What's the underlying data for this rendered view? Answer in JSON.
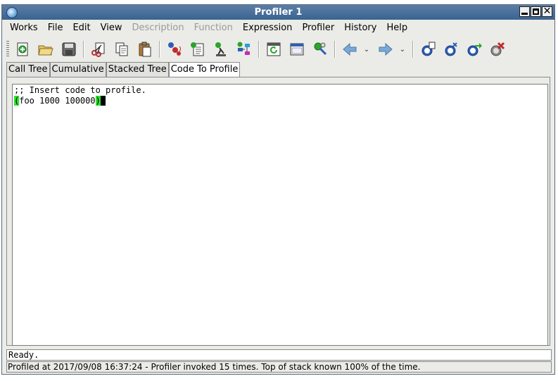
{
  "window": {
    "title": "Profiler 1"
  },
  "menubar": {
    "items": [
      {
        "label": "Works",
        "disabled": false
      },
      {
        "label": "File",
        "disabled": false
      },
      {
        "label": "Edit",
        "disabled": false
      },
      {
        "label": "View",
        "disabled": false
      },
      {
        "label": "Description",
        "disabled": true
      },
      {
        "label": "Function",
        "disabled": true
      },
      {
        "label": "Expression",
        "disabled": false
      },
      {
        "label": "Profiler",
        "disabled": false
      },
      {
        "label": "History",
        "disabled": false
      },
      {
        "label": "Help",
        "disabled": false
      }
    ]
  },
  "toolbar": {
    "icons": [
      "new-icon",
      "open-icon",
      "save-icon",
      "cut-icon",
      "copy-icon",
      "paste-icon",
      "inspect-icon",
      "listener-icon",
      "debug-icon",
      "browser-icon",
      "refresh-icon",
      "window-icon",
      "tools-icon",
      "back-icon",
      "forward-icon",
      "profile-start-icon",
      "profile-stop-icon",
      "profile-export-icon",
      "profile-clear-icon"
    ]
  },
  "tabs": [
    {
      "label": "Call Tree",
      "active": false
    },
    {
      "label": "Cumulative",
      "active": false
    },
    {
      "label": "Stacked Tree",
      "active": false
    },
    {
      "label": "Code To Profile",
      "active": true
    }
  ],
  "editor": {
    "comment_line": ";; Insert code to profile.",
    "code": {
      "open_paren": "(",
      "body": "foo 1000 100000",
      "close_paren": ")"
    },
    "highlight_color": "#2fe22f"
  },
  "status": {
    "message": "Ready.",
    "info": "Profiled at 2017/09/08 16:37:24 - Profiler invoked 15 times. Top of stack known 100% of the time."
  }
}
